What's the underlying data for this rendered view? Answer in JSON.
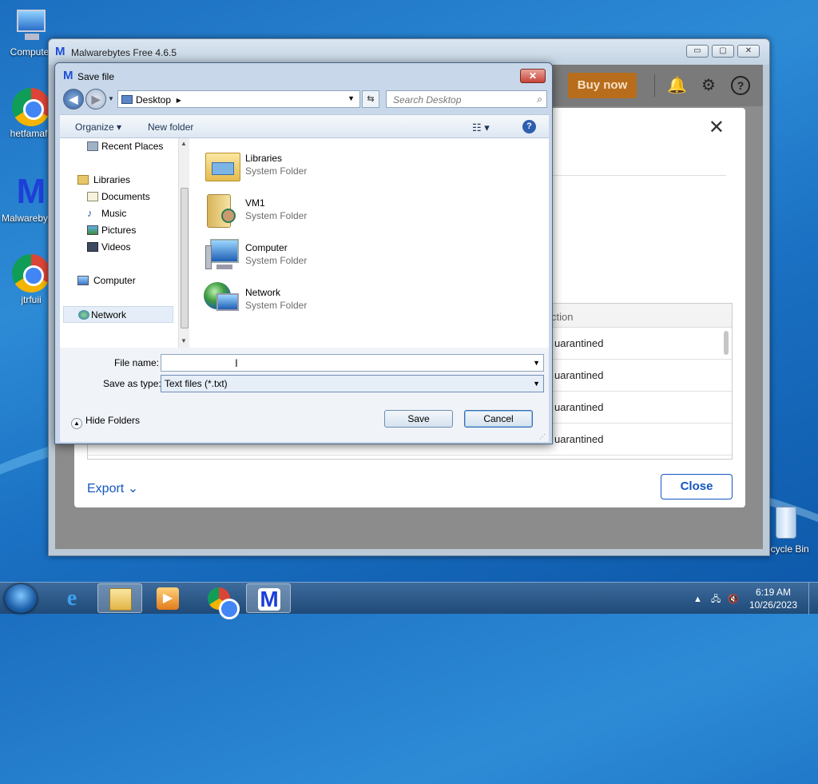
{
  "desktop": {
    "icons": [
      {
        "label": "Computer",
        "icon": "computer-icon"
      },
      {
        "label": "hetfamafc",
        "icon": "chrome-icon"
      },
      {
        "label": "Malwarebytes",
        "icon": "malwarebytes-icon"
      },
      {
        "label": "jtrfuii",
        "icon": "chrome-icon"
      },
      {
        "label": "Recycle Bin",
        "icon": "recycle-bin-icon"
      }
    ]
  },
  "mb_window": {
    "title": "Malwarebytes Free  4.6.5",
    "caption_buttons": {
      "minimize": "▭",
      "maximize": "▢",
      "close": "✕"
    },
    "buy_now": "Buy now",
    "table": {
      "action_header": "ction",
      "rows": [
        "uarantined",
        "uarantined",
        "uarantined",
        "uarantined"
      ]
    },
    "export_label": "Export",
    "close_label": "Close"
  },
  "save_dialog": {
    "title": "Save file",
    "close_glyph": "✕",
    "address": "Desktop",
    "search_placeholder": "Search Desktop",
    "toolbar": {
      "organize": "Organize",
      "new_folder": "New folder",
      "help": "?"
    },
    "nav_items": [
      {
        "label": "Recent Places",
        "icon": "recent-places-icon",
        "indent": 2
      },
      {
        "label": "Libraries",
        "icon": "libraries-icon",
        "indent": 1
      },
      {
        "label": "Documents",
        "icon": "documents-icon",
        "indent": 2
      },
      {
        "label": "Music",
        "icon": "music-icon",
        "indent": 2
      },
      {
        "label": "Pictures",
        "icon": "pictures-icon",
        "indent": 2
      },
      {
        "label": "Videos",
        "icon": "videos-icon",
        "indent": 2
      },
      {
        "label": "Computer",
        "icon": "computer-icon",
        "indent": 1
      },
      {
        "label": "Network",
        "icon": "network-icon",
        "indent": 1,
        "selected": true
      }
    ],
    "files": [
      {
        "name": "Libraries",
        "type": "System Folder",
        "icon": "libraries-folder-icon"
      },
      {
        "name": "VM1",
        "type": "System Folder",
        "icon": "user-folder-icon"
      },
      {
        "name": "Computer",
        "type": "System Folder",
        "icon": "computer-icon"
      },
      {
        "name": "Network",
        "type": "System Folder",
        "icon": "network-icon"
      }
    ],
    "file_name_label": "File name:",
    "file_name_value": "",
    "save_as_type_label": "Save as type:",
    "save_as_type_value": "Text files (*.txt)",
    "hide_folders": "Hide Folders",
    "save_button": "Save",
    "cancel_button": "Cancel"
  },
  "taskbar": {
    "apps": [
      "internet-explorer-icon",
      "file-explorer-icon",
      "media-player-icon",
      "chrome-icon",
      "malwarebytes-icon"
    ],
    "active_app": "malwarebytes-icon",
    "time": "6:19 AM",
    "date": "10/26/2023"
  }
}
